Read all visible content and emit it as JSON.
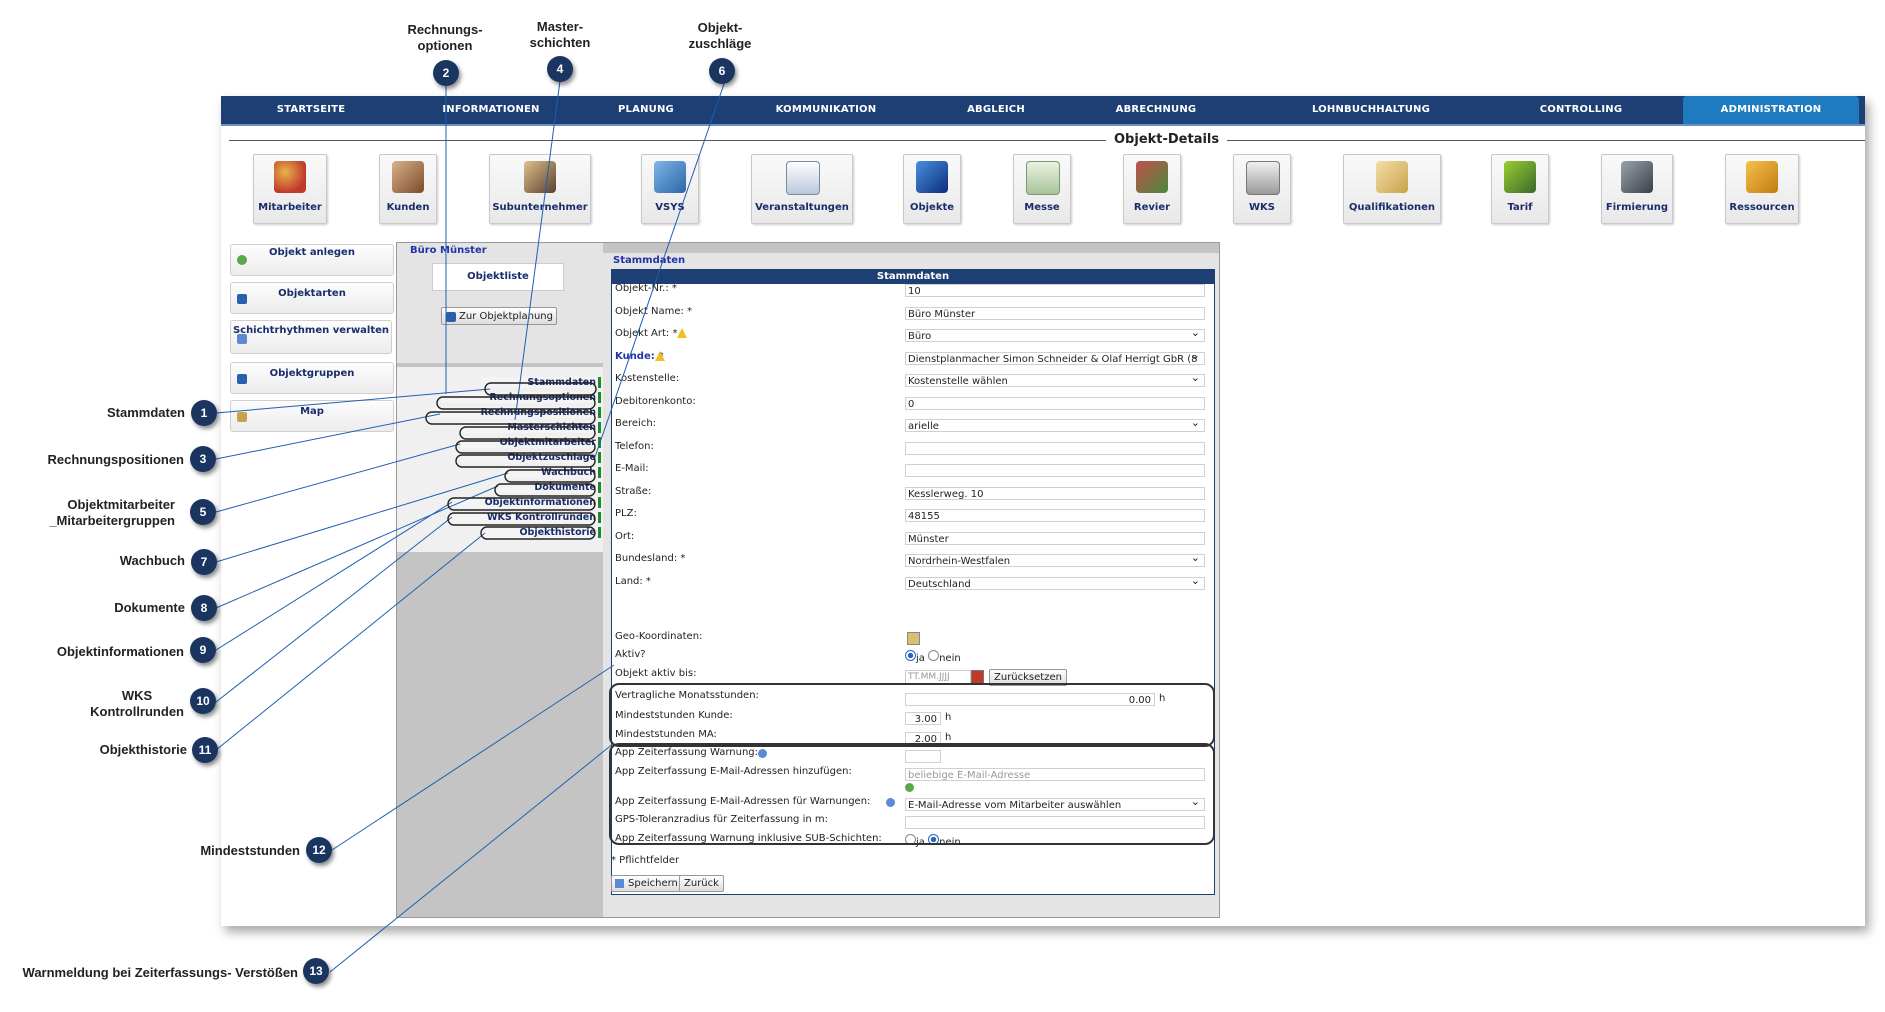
{
  "nav": [
    "STARTSEITE",
    "INFORMATIONEN",
    "PLANUNG",
    "KOMMUNIKATION",
    "ABGLEICH",
    "ABRECHNUNG",
    "LOHNBUCHHALTUNG",
    "CONTROLLING",
    "ADMINISTRATION"
  ],
  "page_title": "Objekt-Details",
  "tiles": [
    "Mitarbeiter",
    "Kunden",
    "Subunternehmer",
    "VSYS",
    "Veranstaltungen",
    "Objekte",
    "Messe",
    "Revier",
    "WKS",
    "Qualifikationen",
    "Tarif",
    "Firmierung",
    "Ressourcen"
  ],
  "sidebar": {
    "buttons": [
      "Objekt anlegen",
      "Objektarten",
      "Schichtrhythmen verwalten",
      "Objektgruppen",
      "Map"
    ]
  },
  "left_panel": {
    "object_name": "Büro Münster",
    "list_button": "Objektliste",
    "planning_button": "Zur Objektplanung",
    "menu": [
      "Stammdaten",
      "Rechnungsoptionen",
      "Rechnungspositionen",
      "Masterschichten",
      "Objektmitarbeiter",
      "Objektzuschläge",
      "Wachbuch",
      "Dokumente",
      "Objektinformationen",
      "WKS Kontrollrunden",
      "Objekthistorie"
    ]
  },
  "main": {
    "section_label": "Stammdaten",
    "table_header": "Stammdaten",
    "fields": [
      {
        "label": "Objekt-Nr.: *",
        "value": "10",
        "type": "text"
      },
      {
        "label": "Objekt Name: *",
        "value": "Büro Münster",
        "type": "text"
      },
      {
        "label": "Objekt Art: *",
        "value": "Büro",
        "type": "select"
      },
      {
        "label": "Kunde: *",
        "value": "Dienstplanmacher Simon Schneider & Olaf Herrigt GbR (8",
        "type": "select"
      },
      {
        "label": "Kostenstelle:",
        "value": "Kostenstelle wählen",
        "type": "select"
      },
      {
        "label": "Debitorenkonto:",
        "value": "0",
        "type": "text"
      },
      {
        "label": "Bereich:",
        "value": "arielle",
        "type": "select"
      },
      {
        "label": "Telefon:",
        "value": "",
        "type": "text"
      },
      {
        "label": "E-Mail:",
        "value": "",
        "type": "text"
      },
      {
        "label": "Straße:",
        "value": "Kesslerweg. 10",
        "type": "text"
      },
      {
        "label": "PLZ:",
        "value": "48155",
        "type": "text"
      },
      {
        "label": "Ort:",
        "value": "Münster",
        "type": "text"
      },
      {
        "label": "Bundesland: *",
        "value": "Nordrhein-Westfalen",
        "type": "select"
      },
      {
        "label": "Land: *",
        "value": "Deutschland",
        "type": "select"
      }
    ],
    "geo_label": "Geo-Koordinaten:",
    "aktiv_label": "Aktiv?",
    "aktiv_yes": "ja",
    "aktiv_no": "nein",
    "aktiv_bis_label": "Objekt aktiv bis:",
    "date_placeholder": "TT.MM.JJJJ",
    "reset_button": "Zurücksetzen",
    "monatsstunden_label": "Vertragliche Monatsstunden:",
    "monatsstunden_value": "0.00",
    "unit_h": "h",
    "min_kunde_label": "Mindeststunden Kunde:",
    "min_kunde_value": "3.00",
    "min_ma_label": "Mindeststunden MA:",
    "min_ma_value": "2.00",
    "app_warn_label": "App Zeiterfassung Warnung:",
    "app_email_add_label": "App Zeiterfassung E-Mail-Adressen hinzufügen:",
    "app_email_placeholder": "beliebige E-Mail-Adresse",
    "app_email_warn_label": "App Zeiterfassung E-Mail-Adressen für Warnungen:",
    "app_email_warn_value": "E-Mail-Adresse vom Mitarbeiter auswählen",
    "gps_label": "GPS-Toleranzradius für Zeiterfassung in m:",
    "sub_label": "App Zeiterfassung Warnung inklusive SUB-Schichten:",
    "sub_yes": "ja",
    "sub_no": "nein",
    "required_note": "* Pflichtfelder",
    "save_button": "Speichern",
    "back_button": "Zurück"
  },
  "callouts": [
    {
      "num": "1",
      "label": "Stammdaten"
    },
    {
      "num": "2",
      "label": "Rechnungs-\noptionen"
    },
    {
      "num": "3",
      "label": "Rechnungspositionen"
    },
    {
      "num": "4",
      "label": "Master-\nschichten"
    },
    {
      "num": "5",
      "label": "Objektmitarbeiter\n_Mitarbeitergruppen"
    },
    {
      "num": "6",
      "label": "Objekt-\nzuschläge"
    },
    {
      "num": "7",
      "label": "Wachbuch"
    },
    {
      "num": "8",
      "label": "Dokumente"
    },
    {
      "num": "9",
      "label": "Objektinformationen"
    },
    {
      "num": "10",
      "label": "WKS\nKontrollrunden"
    },
    {
      "num": "11",
      "label": "Objekthistorie"
    },
    {
      "num": "12",
      "label": "Mindeststunden"
    },
    {
      "num": "13",
      "label": "Warnmeldung bei Zeiterfassungs- Verstößen"
    }
  ],
  "colors": {
    "nav_bg": "#1e3f73",
    "nav_active": "#1f7bc0",
    "callout": "#1b3561",
    "menu_accent": "#1c8a2a"
  }
}
